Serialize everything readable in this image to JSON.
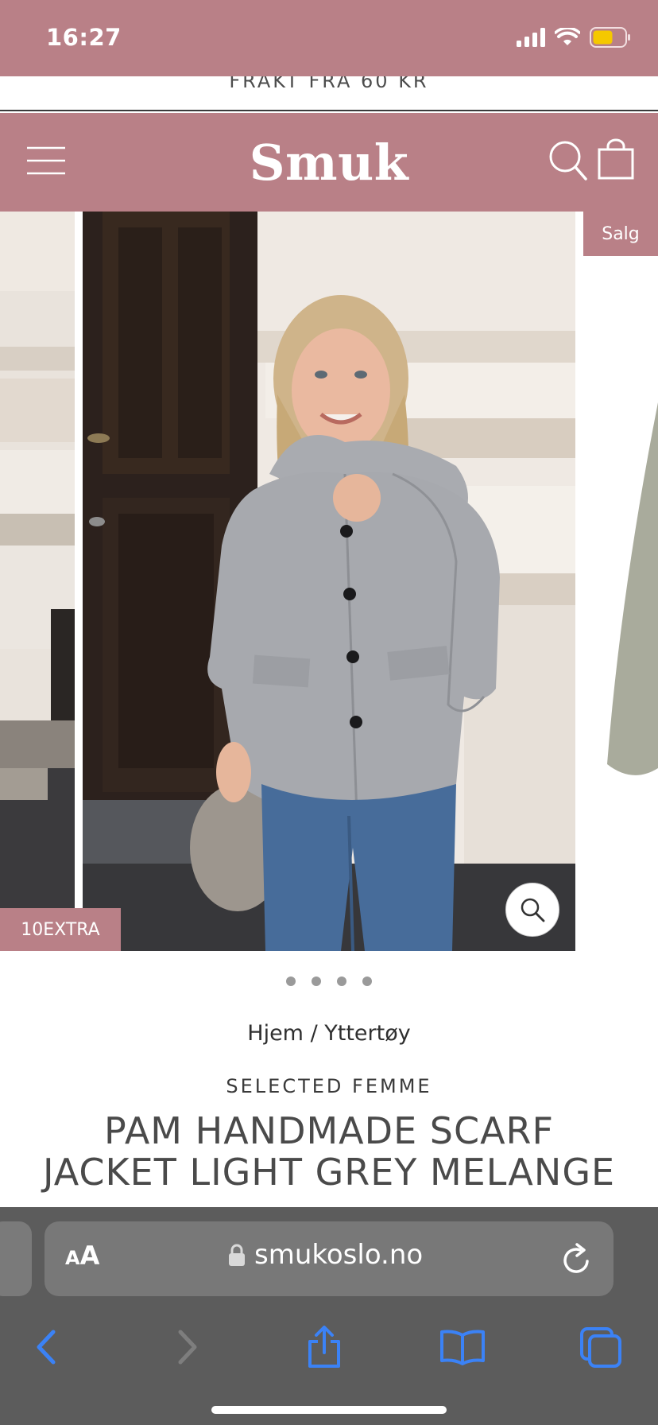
{
  "status_bar": {
    "time": "16:27",
    "icons": [
      "signal-icon",
      "wifi-icon",
      "battery-icon"
    ],
    "battery_color": "#f5c800"
  },
  "promo": {
    "text": "FRAKT FRA 60 KR"
  },
  "header": {
    "logo": "Smuk",
    "background": "#b98087",
    "icons": [
      "menu-icon",
      "search-icon",
      "shopping-bag-icon"
    ]
  },
  "gallery": {
    "badge_sale": "Salg",
    "badge_code": "10EXTRA",
    "zoom_icon": "zoom-icon",
    "dot_count": 4
  },
  "product": {
    "breadcrumb": {
      "home": "Hjem",
      "separator": " / ",
      "category": "Yttertøy"
    },
    "brand": "SELECTED FEMME",
    "title": "PAM HANDMADE SCARF JACKET LIGHT GREY MELANGE"
  },
  "browser": {
    "aa_label_small": "A",
    "aa_label_big": "A",
    "url": "smukoslo.no",
    "accent": "#3b82f6",
    "toolbar_icons": [
      "back-icon",
      "forward-icon",
      "share-icon",
      "bookmarks-icon",
      "tabs-icon"
    ]
  }
}
